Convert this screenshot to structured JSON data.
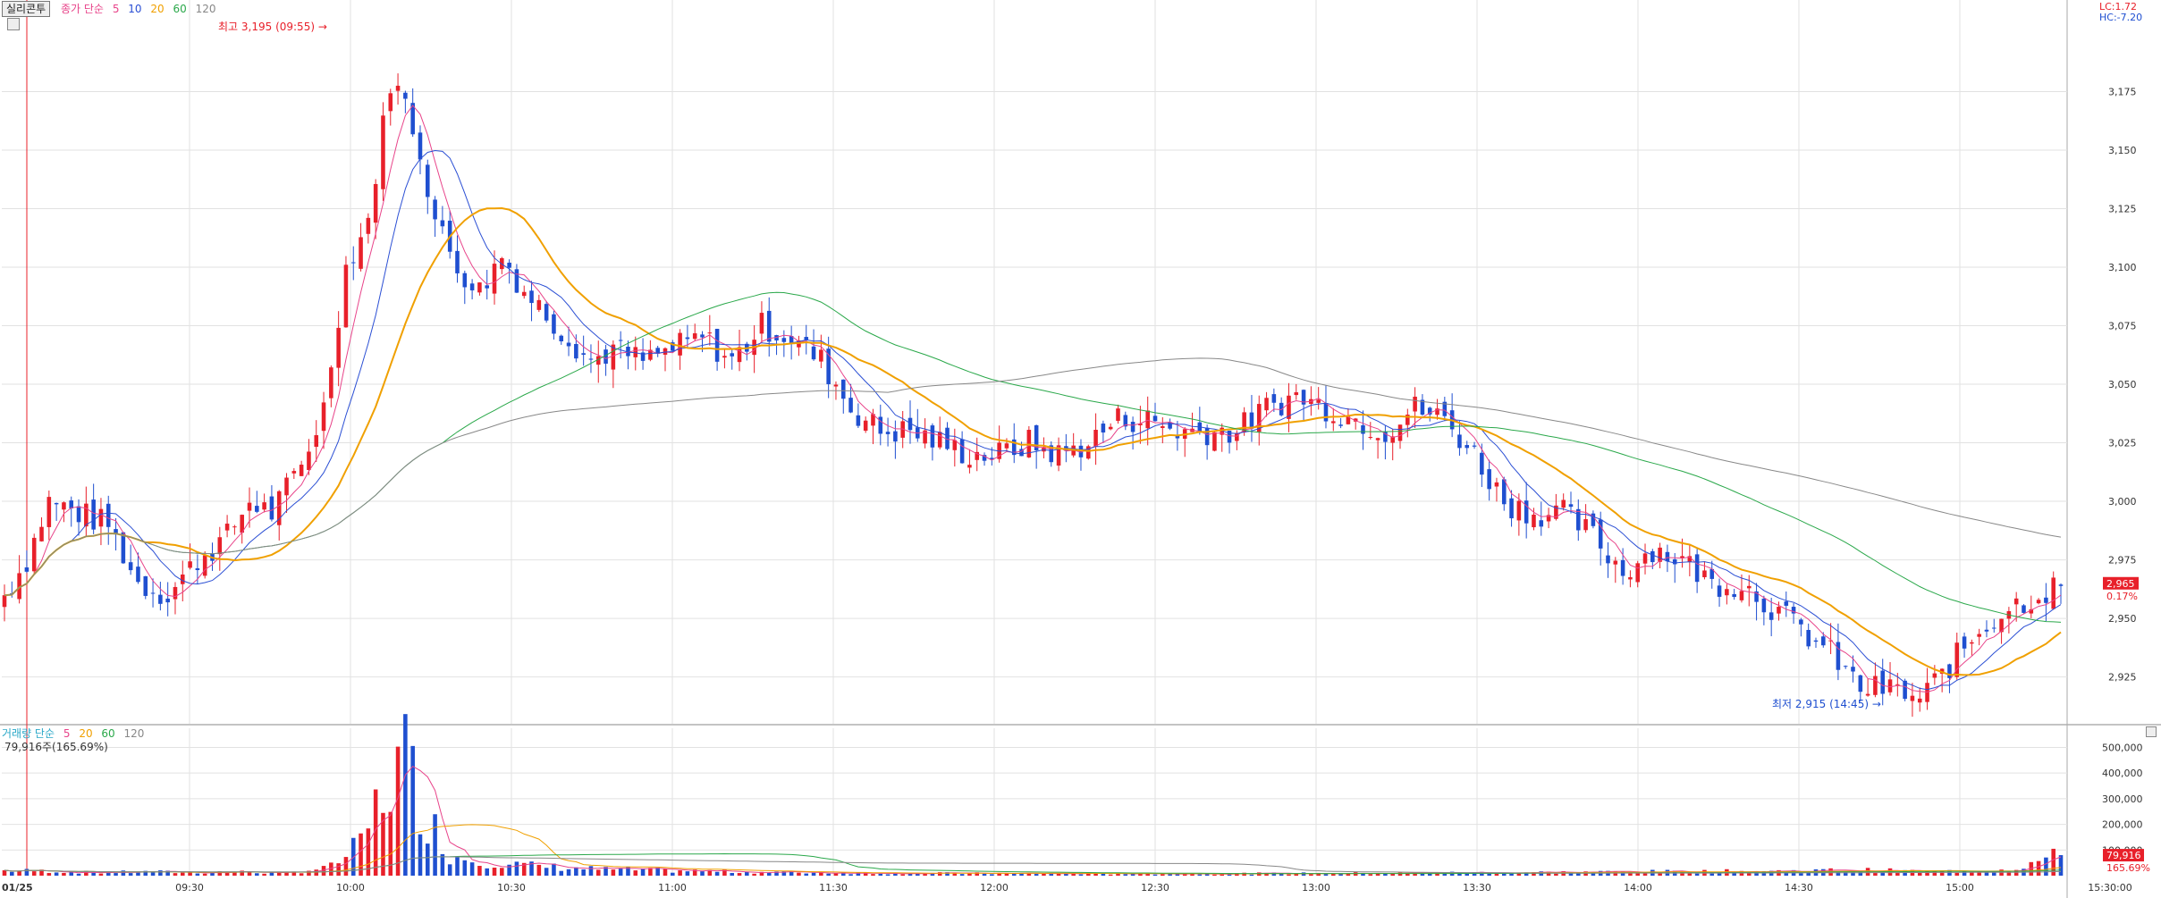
{
  "toolbar": {
    "tab_label": "실리콘투",
    "price_legend": {
      "title": "종가 단순",
      "periods": [
        {
          "label": "5",
          "color": "#e8448a"
        },
        {
          "label": "10",
          "color": "#2b4fd4"
        },
        {
          "label": "20",
          "color": "#f0a000"
        },
        {
          "label": "60",
          "color": "#2aa84a"
        },
        {
          "label": "120",
          "color": "#888888"
        }
      ]
    },
    "volume_legend": {
      "title": "거래량 단순",
      "periods": [
        {
          "label": "5",
          "color": "#e8448a"
        },
        {
          "label": "20",
          "color": "#f0a000"
        },
        {
          "label": "60",
          "color": "#2aa84a"
        },
        {
          "label": "120",
          "color": "#888888"
        }
      ]
    },
    "lc_text": "LC:1.72",
    "hc_text": "HC:-7.20",
    "volume_info": "79,916주(165.69%)"
  },
  "colors": {
    "up": "#e8202a",
    "down": "#1f4fd0",
    "grid": "#e2e2e2",
    "axis_text": "#333333",
    "current_bg": "#e8202a"
  },
  "chart_data": {
    "type": "candlestick",
    "date": "01/25",
    "x_tick_labels": [
      "01/25",
      "09:30",
      "10:00",
      "10:30",
      "11:00",
      "11:30",
      "12:00",
      "12:30",
      "13:00",
      "13:30",
      "14:00",
      "14:30",
      "15:00",
      "15:30:00"
    ],
    "price_axis": {
      "ylim": [
        2905,
        3208
      ],
      "ticks": [
        "3,175",
        "3,150",
        "3,125",
        "3,100",
        "3,075",
        "3,050",
        "3,025",
        "3,000",
        "2,975",
        "2,950",
        "2,925"
      ]
    },
    "volume_axis": {
      "ylim": [
        0,
        540000
      ],
      "ticks": [
        "500,000",
        "400,000",
        "300,000",
        "200,000",
        "100,000"
      ]
    },
    "high_annotation": "최고 3,195 (09:55)",
    "low_annotation": "최저 2,915 (14:45)",
    "current_price_label": "2,965",
    "current_change_label": "0.17%",
    "current_volume_label": "79,916",
    "current_volume_pct_label": "165.69%",
    "close_price_path": [
      [
        0,
        2960
      ],
      [
        3,
        2975
      ],
      [
        6,
        3000
      ],
      [
        10,
        2995
      ],
      [
        14,
        2990
      ],
      [
        18,
        2965
      ],
      [
        22,
        2960
      ],
      [
        26,
        2975
      ],
      [
        30,
        2985
      ],
      [
        33,
        3000
      ],
      [
        36,
        2995
      ],
      [
        40,
        3015
      ],
      [
        43,
        3040
      ],
      [
        46,
        3100
      ],
      [
        49,
        3120
      ],
      [
        52,
        3180
      ],
      [
        54,
        3170
      ],
      [
        56,
        3150
      ],
      [
        58,
        3120
      ],
      [
        61,
        3100
      ],
      [
        64,
        3090
      ],
      [
        67,
        3105
      ],
      [
        70,
        3090
      ],
      [
        73,
        3080
      ],
      [
        76,
        3070
      ],
      [
        79,
        3060
      ],
      [
        82,
        3065
      ],
      [
        86,
        3060
      ],
      [
        90,
        3065
      ],
      [
        94,
        3070
      ],
      [
        98,
        3060
      ],
      [
        102,
        3075
      ],
      [
        106,
        3070
      ],
      [
        110,
        3060
      ],
      [
        114,
        3040
      ],
      [
        118,
        3030
      ],
      [
        122,
        3030
      ],
      [
        126,
        3025
      ],
      [
        130,
        3020
      ],
      [
        134,
        3020
      ],
      [
        138,
        3025
      ],
      [
        142,
        3020
      ],
      [
        146,
        3025
      ],
      [
        150,
        3035
      ],
      [
        154,
        3035
      ],
      [
        158,
        3030
      ],
      [
        162,
        3030
      ],
      [
        166,
        3030
      ],
      [
        170,
        3040
      ],
      [
        174,
        3045
      ],
      [
        178,
        3040
      ],
      [
        182,
        3035
      ],
      [
        186,
        3030
      ],
      [
        190,
        3040
      ],
      [
        194,
        3035
      ],
      [
        198,
        3020
      ],
      [
        202,
        3000
      ],
      [
        206,
        2995
      ],
      [
        210,
        2995
      ],
      [
        214,
        2985
      ],
      [
        218,
        2970
      ],
      [
        222,
        2980
      ],
      [
        226,
        2975
      ],
      [
        230,
        2965
      ],
      [
        234,
        2965
      ],
      [
        238,
        2955
      ],
      [
        242,
        2945
      ],
      [
        246,
        2935
      ],
      [
        250,
        2920
      ],
      [
        254,
        2920
      ],
      [
        258,
        2915
      ],
      [
        262,
        2930
      ],
      [
        266,
        2945
      ],
      [
        270,
        2955
      ],
      [
        274,
        2960
      ],
      [
        277,
        2965
      ]
    ],
    "volume_path": [
      [
        0,
        20000
      ],
      [
        6,
        18000
      ],
      [
        12,
        12000
      ],
      [
        20,
        15000
      ],
      [
        26,
        12000
      ],
      [
        30,
        16000
      ],
      [
        38,
        10000
      ],
      [
        40,
        18000
      ],
      [
        44,
        35000
      ],
      [
        48,
        120000
      ],
      [
        50,
        260000
      ],
      [
        52,
        380000
      ],
      [
        54,
        460000
      ],
      [
        56,
        300000
      ],
      [
        58,
        180000
      ],
      [
        60,
        80000
      ],
      [
        64,
        60000
      ],
      [
        70,
        40000
      ],
      [
        80,
        25000
      ],
      [
        90,
        20000
      ],
      [
        100,
        15000
      ],
      [
        110,
        12000
      ],
      [
        120,
        10000
      ],
      [
        140,
        8000
      ],
      [
        160,
        8000
      ],
      [
        180,
        9000
      ],
      [
        200,
        12000
      ],
      [
        220,
        15000
      ],
      [
        240,
        18000
      ],
      [
        250,
        22000
      ],
      [
        260,
        15000
      ],
      [
        270,
        25000
      ],
      [
        277,
        79916
      ]
    ]
  }
}
